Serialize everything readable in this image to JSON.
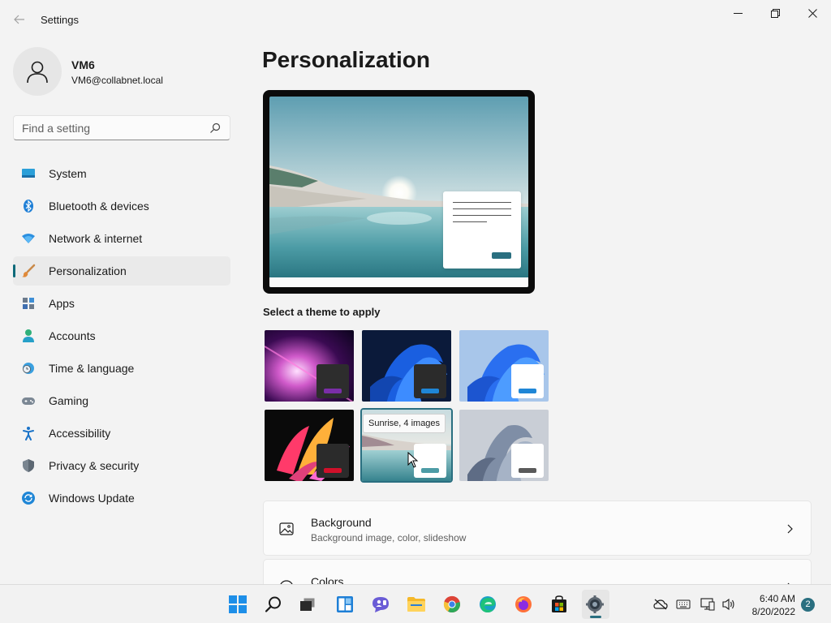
{
  "window": {
    "app_title": "Settings"
  },
  "user": {
    "name": "VM6",
    "email": "VM6@collabnet.local"
  },
  "search": {
    "placeholder": "Find a setting"
  },
  "sidebar": {
    "items": [
      {
        "label": "System",
        "icon": "system-icon"
      },
      {
        "label": "Bluetooth & devices",
        "icon": "bluetooth-icon"
      },
      {
        "label": "Network & internet",
        "icon": "network-icon"
      },
      {
        "label": "Personalization",
        "icon": "paintbrush-icon",
        "active": true
      },
      {
        "label": "Apps",
        "icon": "apps-icon"
      },
      {
        "label": "Accounts",
        "icon": "accounts-icon"
      },
      {
        "label": "Time & language",
        "icon": "clock-globe-icon"
      },
      {
        "label": "Gaming",
        "icon": "gamepad-icon"
      },
      {
        "label": "Accessibility",
        "icon": "accessibility-icon"
      },
      {
        "label": "Privacy & security",
        "icon": "shield-icon"
      },
      {
        "label": "Windows Update",
        "icon": "update-icon"
      }
    ]
  },
  "main": {
    "title": "Personalization",
    "themes_label": "Select a theme to apply",
    "tooltip": "Sunrise, 4 images",
    "cards": [
      {
        "title": "Background",
        "subtitle": "Background image, color, slideshow",
        "icon": "image-icon"
      },
      {
        "title": "Colors",
        "subtitle": "",
        "icon": "palette-icon"
      }
    ]
  },
  "taskbar": {
    "time": "6:40 AM",
    "date": "8/20/2022",
    "notification_count": "2"
  },
  "colors": {
    "accent": "#2a6f80"
  }
}
